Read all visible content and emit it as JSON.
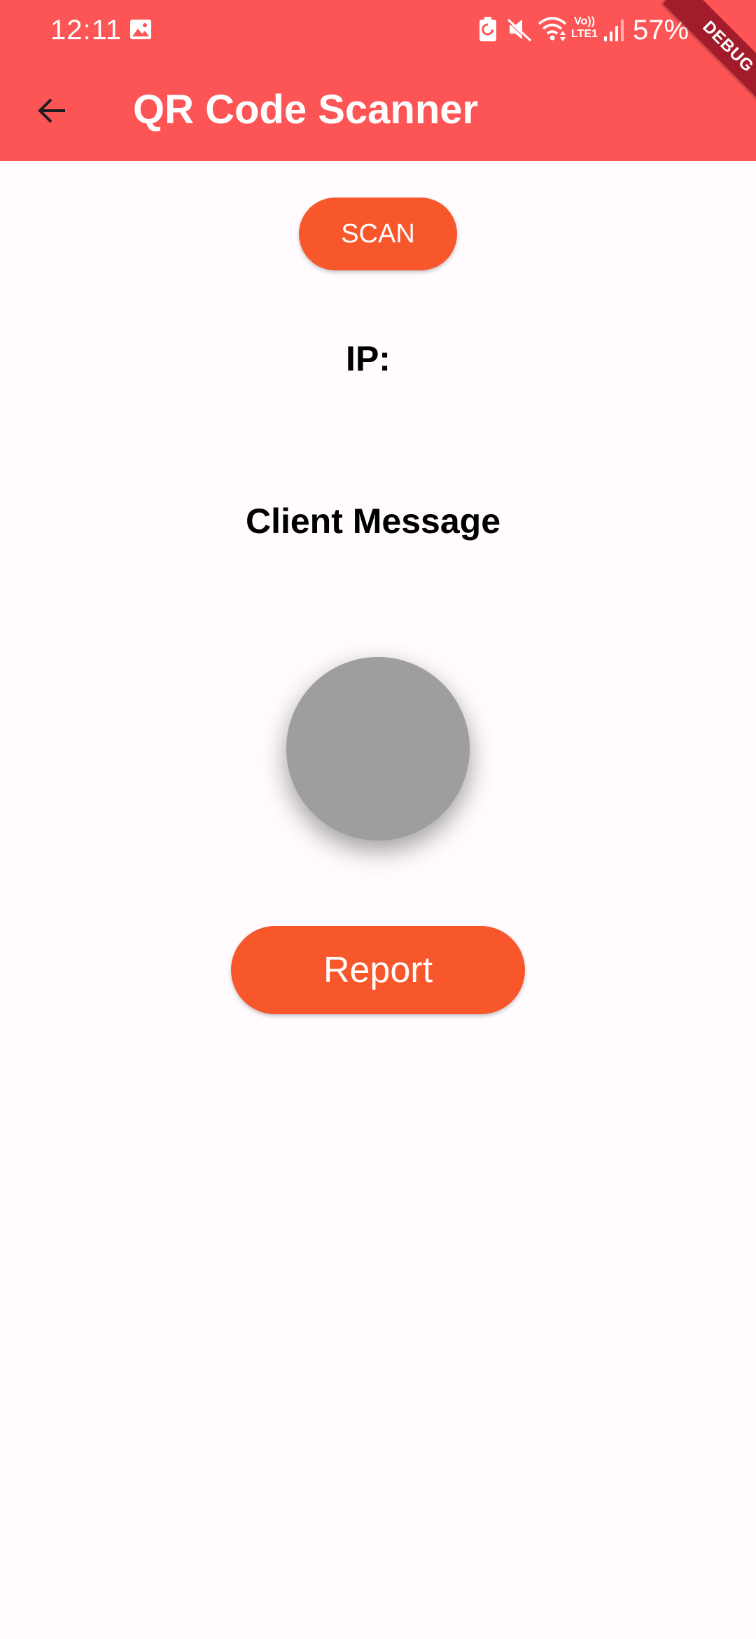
{
  "status_bar": {
    "time": "12:11",
    "network_label": "Vo))\nLTE1",
    "battery": "57%"
  },
  "debug_banner": "DEBUG",
  "app_bar": {
    "title": "QR Code Scanner",
    "back_icon": "arrow-back-icon"
  },
  "content": {
    "scan_label": "SCAN",
    "ip_label": "IP:",
    "client_message_label": "Client Message",
    "indicator_color": "#9e9e9e",
    "report_label": "Report"
  },
  "colors": {
    "app_bar": "#fd5555",
    "button": "#f7572b",
    "background": "#fffbfe",
    "debug_ribbon": "#a31c2b"
  }
}
